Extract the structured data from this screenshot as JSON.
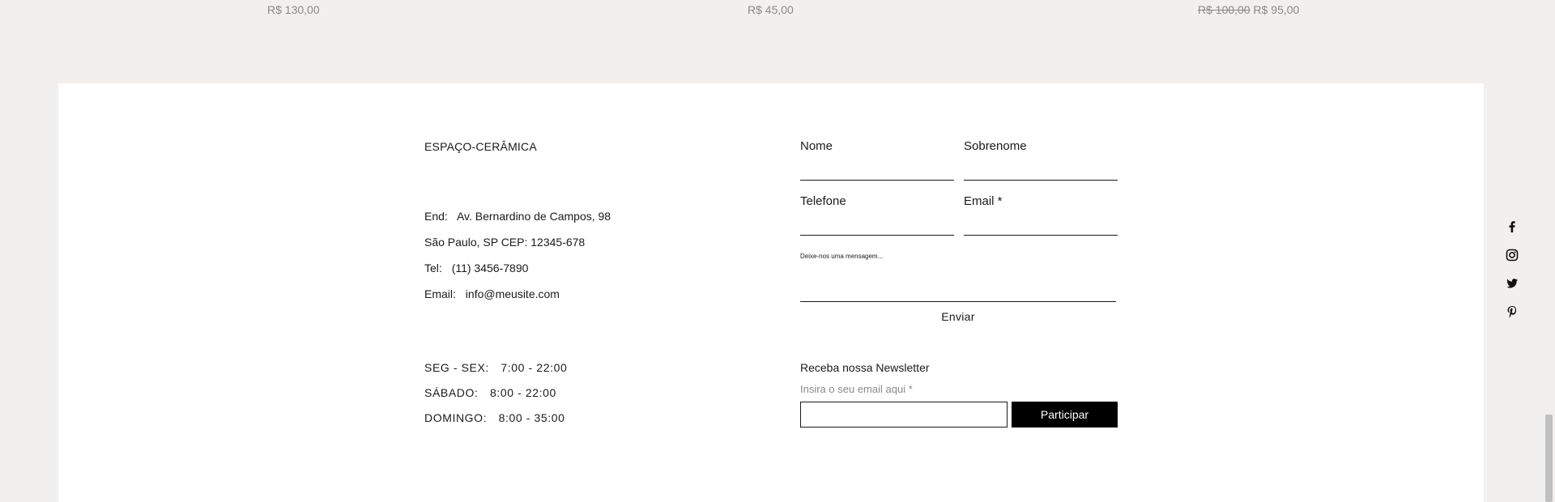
{
  "products": {
    "prices": [
      {
        "current": "R$ 130,00"
      },
      {
        "current": "R$ 45,00"
      },
      {
        "original": "R$ 100,00",
        "current": "R$ 95,00"
      }
    ]
  },
  "footer": {
    "brand": "ESPAÇO-CERÂMICA",
    "contact": {
      "address_label": "End:",
      "address_line1": "Av. Bernardino de Campos, 98",
      "address_line2": "São Paulo, SP CEP: 12345-678",
      "phone_label": "Tel:",
      "phone": "(11) 3456-7890",
      "email_label": "Email:",
      "email": "info@meusite.com"
    },
    "hours": [
      {
        "label": "SEG - SEX:",
        "value": "7:00 - 22:00"
      },
      {
        "label": "SÁBADO:",
        "value": "8:00 - 22:00"
      },
      {
        "label": "DOMINGO:",
        "value": "8:00 - 35:00"
      }
    ],
    "form": {
      "first_name_label": "Nome",
      "last_name_label": "Sobrenome",
      "phone_label": "Telefone",
      "email_label": "Email *",
      "message_placeholder": "Deixe-nos uma mensagem...",
      "submit_label": "Enviar"
    },
    "newsletter": {
      "title": "Receba nossa Newsletter",
      "hint": "Insira o seu email aqui *",
      "button_label": "Participar"
    },
    "social": [
      "facebook-icon",
      "instagram-icon",
      "twitter-icon",
      "pinterest-icon"
    ]
  },
  "colors": {
    "background": "#f1f0ee",
    "panel": "#ffffff",
    "text": "#1a1a1a",
    "muted": "#8a8a8a",
    "button": "#000000"
  }
}
